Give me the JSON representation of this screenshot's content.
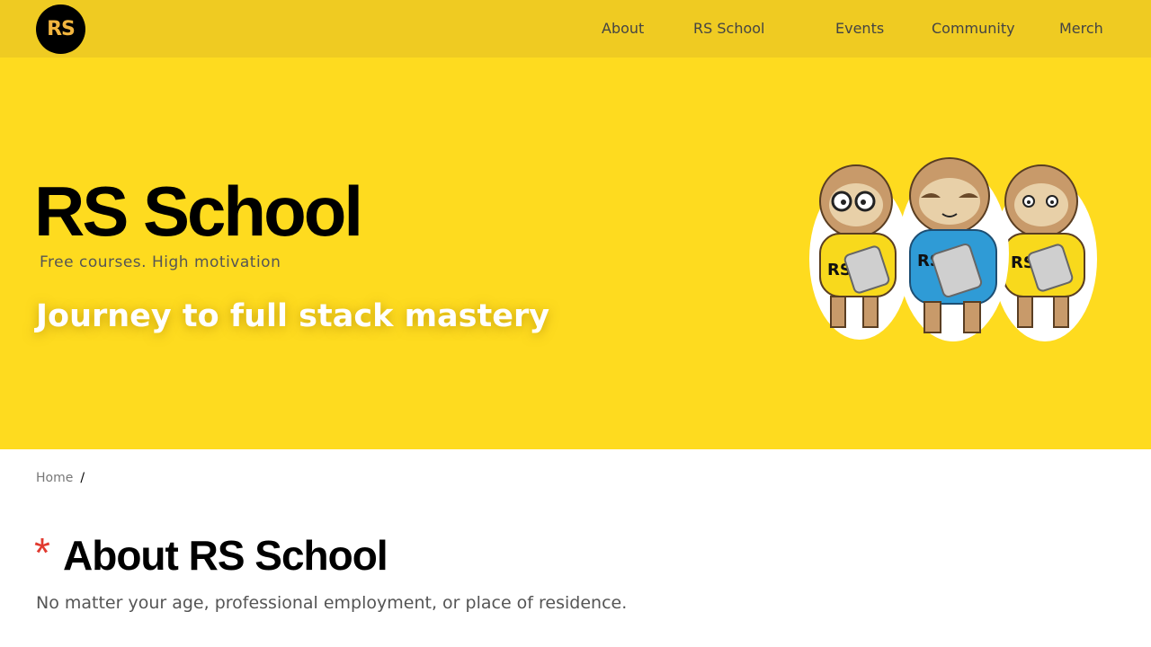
{
  "header": {
    "logo_text": "RS",
    "nav": [
      {
        "label": "About"
      },
      {
        "label": "RS School"
      },
      {
        "label": "Events"
      },
      {
        "label": "Community"
      },
      {
        "label": "Merch"
      }
    ]
  },
  "hero": {
    "title": "RS School",
    "tagline": "Free courses. High motivation",
    "subtitle": "Journey to full stack mastery",
    "mascot_shirt_text": "RS"
  },
  "breadcrumb": {
    "home": "Home",
    "separator": "/"
  },
  "section": {
    "marker": "*",
    "title": "About RS School",
    "description": "No matter your age, professional employment, or place of residence."
  },
  "colors": {
    "header_bg": "#efcb22",
    "hero_bg": "#fedb1f",
    "accent_red": "#e13a2f",
    "logo_text": "#f2b53f"
  }
}
